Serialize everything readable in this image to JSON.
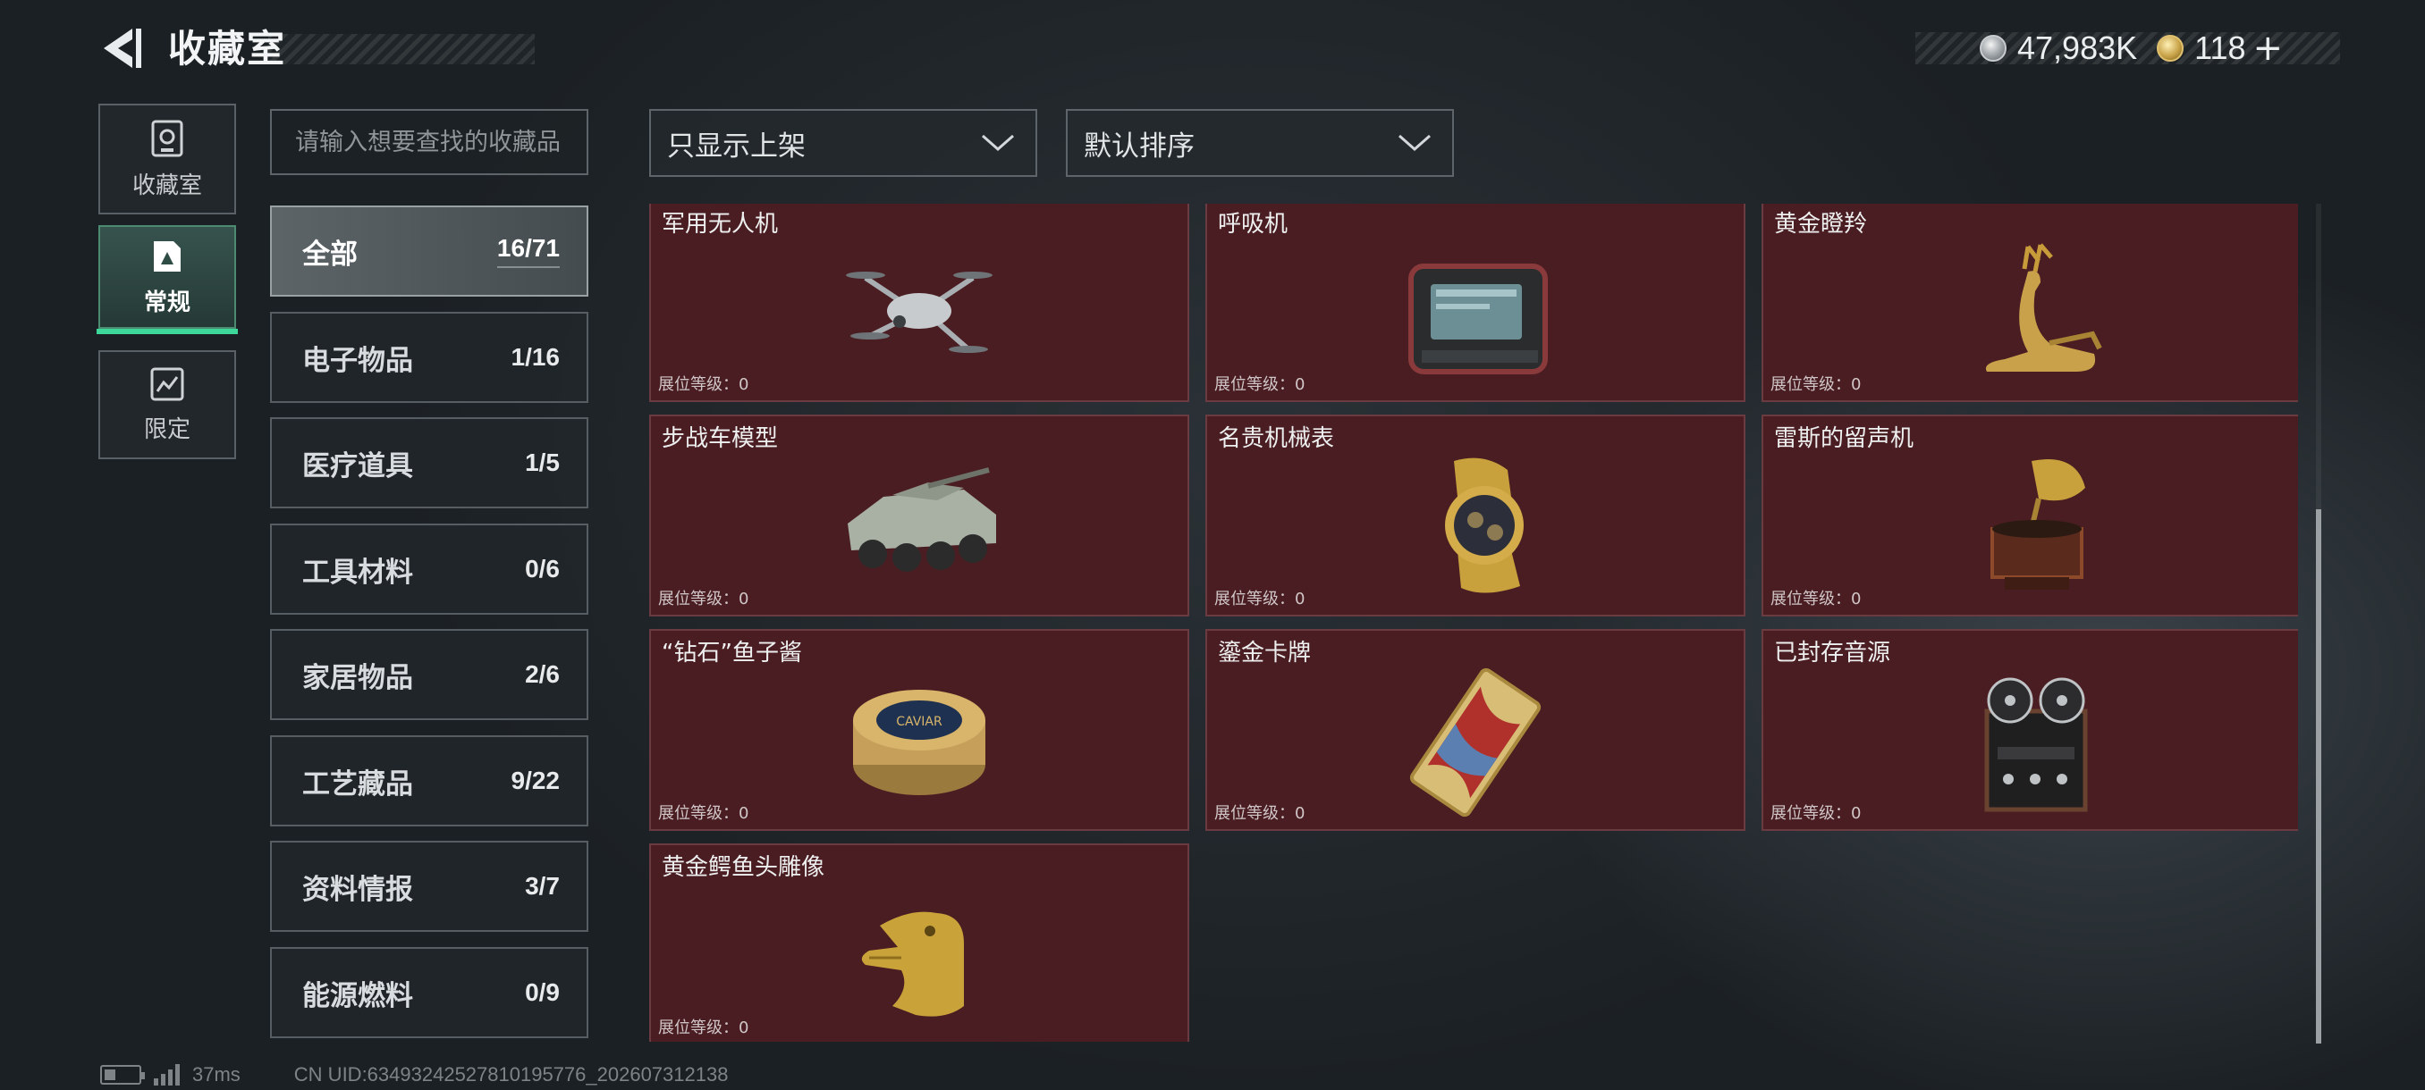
{
  "header": {
    "title": "收藏室",
    "back_icon": "back-arrow-icon"
  },
  "currency": [
    {
      "icon": "silver-coin-icon",
      "value": "47,983K"
    },
    {
      "icon": "gold-coin-icon",
      "value": "118",
      "plus": "+"
    }
  ],
  "rail": [
    {
      "label": "收藏室",
      "icon": "collection-room-icon"
    },
    {
      "label": "常规",
      "icon": "regular-icon",
      "active": true
    },
    {
      "label": "限定",
      "icon": "limited-icon"
    }
  ],
  "search": {
    "placeholder": "请输入想要查找的收藏品"
  },
  "filters": {
    "display": "只显示上架",
    "sort": "默认排序"
  },
  "categories": [
    {
      "name": "全部",
      "count": "16/71",
      "active": true
    },
    {
      "name": "电子物品",
      "count": "1/16"
    },
    {
      "name": "医疗道具",
      "count": "1/5"
    },
    {
      "name": "工具材料",
      "count": "0/6"
    },
    {
      "name": "家居物品",
      "count": "2/6"
    },
    {
      "name": "工艺藏品",
      "count": "9/22"
    },
    {
      "name": "资料情报",
      "count": "3/7"
    },
    {
      "name": "能源燃料",
      "count": "0/9"
    }
  ],
  "items": [
    {
      "name": "军用无人机",
      "level": "展位等级：0",
      "icon": "drone-icon"
    },
    {
      "name": "呼吸机",
      "level": "展位等级：0",
      "icon": "ventilator-icon"
    },
    {
      "name": "黄金瞪羚",
      "level": "展位等级：0",
      "icon": "golden-gazelle-icon"
    },
    {
      "name": "步战车模型",
      "level": "展位等级：0",
      "icon": "ifv-model-icon"
    },
    {
      "name": "名贵机械表",
      "level": "展位等级：0",
      "icon": "watch-icon"
    },
    {
      "name": "雷斯的留声机",
      "level": "展位等级：0",
      "icon": "gramophone-icon"
    },
    {
      "name": "“钻石”鱼子酱",
      "level": "展位等级：0",
      "icon": "caviar-tin-icon"
    },
    {
      "name": "鎏金卡牌",
      "level": "展位等级：0",
      "icon": "gilded-card-icon"
    },
    {
      "name": "已封存音源",
      "level": "展位等级：0",
      "icon": "reel-recorder-icon"
    },
    {
      "name": "黄金鳄鱼头雕像",
      "level": "展位等级：0",
      "icon": "golden-croc-statue-icon"
    }
  ],
  "item_art_labels": {
    "caviar": "CAVIAR"
  },
  "footer": {
    "ping": "37ms",
    "uid": "CN UID:634932425278101957​76_202607312138"
  }
}
